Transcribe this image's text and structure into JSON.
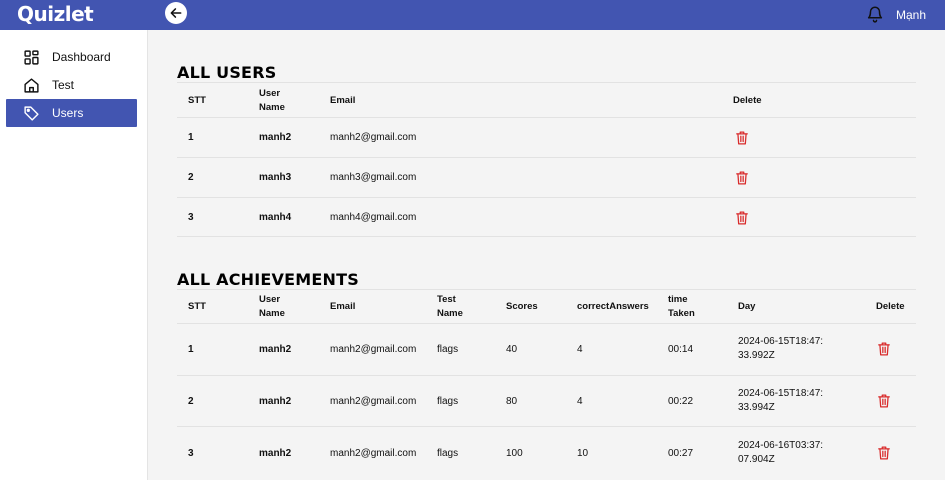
{
  "header": {
    "logo": "Quizlet",
    "username": "Mạnh"
  },
  "sidebar": {
    "items": [
      {
        "label": "Dashboard",
        "icon": "dashboard-icon",
        "active": false
      },
      {
        "label": "Test",
        "icon": "home-icon",
        "active": false
      },
      {
        "label": "Users",
        "icon": "tag-icon",
        "active": true
      }
    ]
  },
  "users_section": {
    "title": "ALL USERS",
    "columns": {
      "stt": "STT",
      "username": "User Name",
      "email": "Email",
      "delete": "Delete"
    },
    "rows": [
      {
        "stt": "1",
        "username": "manh2",
        "email": "manh2@gmail.com"
      },
      {
        "stt": "2",
        "username": "manh3",
        "email": "manh3@gmail.com"
      },
      {
        "stt": "3",
        "username": "manh4",
        "email": "manh4@gmail.com"
      }
    ]
  },
  "achievements_section": {
    "title": "ALL ACHIEVEMENTS",
    "columns": {
      "stt": "STT",
      "username": "User Name",
      "email": "Email",
      "testname": "Test Name",
      "scores": "Scores",
      "correct": "correctAnswers",
      "time": "time Taken",
      "day": "Day",
      "delete": "Delete"
    },
    "rows": [
      {
        "stt": "1",
        "username": "manh2",
        "email": "manh2@gmail.com",
        "testname": "flags",
        "scores": "40",
        "correct": "4",
        "time": "00:14",
        "day": "2024-06-15T18:47:33.992Z"
      },
      {
        "stt": "2",
        "username": "manh2",
        "email": "manh2@gmail.com",
        "testname": "flags",
        "scores": "80",
        "correct": "4",
        "time": "00:22",
        "day": "2024-06-15T18:47:33.994Z"
      },
      {
        "stt": "3",
        "username": "manh2",
        "email": "manh2@gmail.com",
        "testname": "flags",
        "scores": "100",
        "correct": "10",
        "time": "00:27",
        "day": "2024-06-16T03:37:07.904Z"
      }
    ]
  },
  "colors": {
    "primary": "#4255b1",
    "delete": "#d92b2b"
  }
}
